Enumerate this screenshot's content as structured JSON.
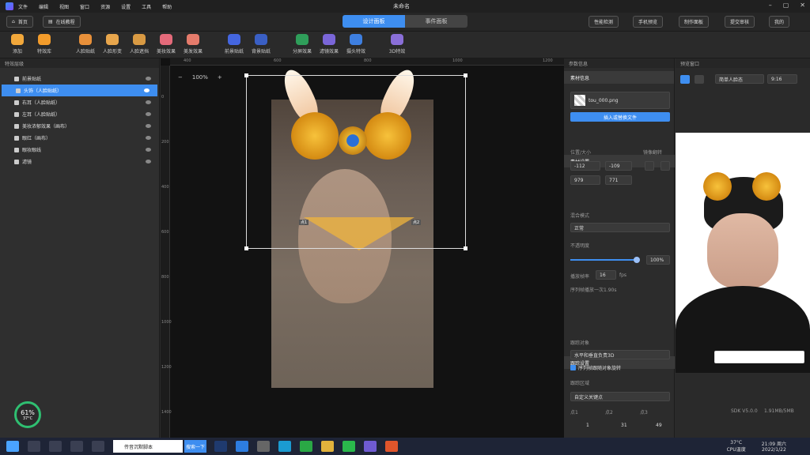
{
  "menu": {
    "items": [
      "文件",
      "编辑",
      "视图",
      "窗口",
      "资源",
      "设置",
      "工具",
      "帮助"
    ],
    "title": "未命名"
  },
  "topbar": {
    "home": "首页",
    "tutorial": "在线教程",
    "tabs": [
      "设计面板",
      "事件面板"
    ],
    "active_tab": 0,
    "right": [
      "性能检测",
      "手机预览",
      "制作面板",
      "提交审核",
      "我的"
    ]
  },
  "tools": [
    "添加",
    "特效库",
    "人脸贴纸",
    "人脸形变",
    "人脸遮挡",
    "美妆效果",
    "美发效果",
    "前景贴纸",
    "背景贴纸",
    "分屏效果",
    "滤镜效果",
    "摄头特效",
    "3D特效"
  ],
  "left": {
    "title": "特效层级",
    "layers": [
      "前景贴纸",
      "头饰（人脸贴纸）",
      "右耳（人脸贴纸）",
      "左耳（人脸贴纸）",
      "美妆浓郁效果（画布）",
      "眼红（画布）",
      "眼妆眼线",
      "滤镜"
    ],
    "selected": 1
  },
  "canvas": {
    "zoom": "100%",
    "ticks_top": [
      "400",
      "600",
      "800",
      "1000",
      "1200"
    ],
    "ticks_left": [
      "0",
      "200",
      "400",
      "600",
      "800",
      "1000",
      "1200",
      "1400"
    ],
    "handle_labels": [
      "点1",
      "点2"
    ]
  },
  "mid": {
    "title": "参数信息",
    "material": "素材信息",
    "filename": "tou_000.png",
    "replace_btn": "插入或替换文件",
    "material_settings": "素材设置",
    "pos_size": "位置/大小",
    "flip": "镜像翻转",
    "x": "-112",
    "y": "-109",
    "w": "979",
    "h": "771",
    "blend_label": "混合模式",
    "blend": "正常",
    "opacity_label": "不透明度",
    "opacity": "100%",
    "opacity_value": 1.0,
    "fps_label": "播放帧率",
    "fps": "16",
    "fps_unit": "fps",
    "seq_text": "序列帧播放一次1.90s",
    "track": "跟踪设置",
    "track_obj_label": "跟踪对象",
    "track_obj": "水平和垂直负责3D",
    "track_check": "序列帧跟随对象旋转",
    "track_area_label": "跟踪区域",
    "track_area": "自定义关键点",
    "pts": [
      "点1",
      "点2",
      "点3"
    ],
    "pt_values": [
      "1",
      "31",
      "49"
    ]
  },
  "right": {
    "title": "预览窗口",
    "mode": "简单人脸态",
    "ratio": "9:16",
    "sdk": "SDK V5.0.0",
    "res": "1.91MB/5MB"
  },
  "taskbar": {
    "search": "传音沉默脚本",
    "search_btn": "搜索一下",
    "temp": "37°C",
    "cpu": "CPU温度",
    "time": "21:09 周六",
    "date": "2022/1/22"
  },
  "cpu": {
    "pct": "61%",
    "temp": "37°C"
  }
}
